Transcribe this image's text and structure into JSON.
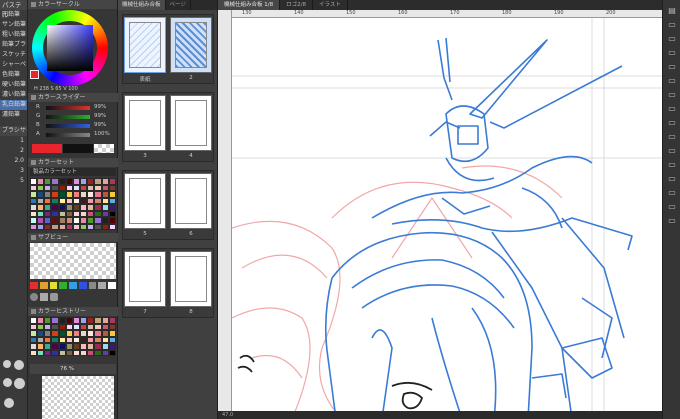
{
  "left_tools": {
    "header": "パステル",
    "items": [
      "円鉛筆",
      "サン鉛筆",
      "粗い鉛筆",
      "鉛筆ブラシ",
      "スケッチ",
      "シャーペン",
      "色鉛筆",
      "硬い鉛筆",
      "濃い鉛筆",
      "乳白鉛筆",
      "濃鉛筆"
    ],
    "selected_index": 9,
    "sub_header": "ブラシサイズ",
    "size_values": [
      "1",
      "2",
      "2.0",
      "3",
      "5"
    ]
  },
  "color_panel": {
    "wheel_title": "カラーサークル",
    "hsv_readout": "H 238 S 65 V 100",
    "slider_title": "カラースライダー",
    "sliders": [
      {
        "label": "R",
        "value": "99%",
        "color": "#e03030"
      },
      {
        "label": "G",
        "value": "99%",
        "color": "#30b030"
      },
      {
        "label": "B",
        "value": "99%",
        "color": "#3060e0"
      },
      {
        "label": "A",
        "value": "100%",
        "color": "#888888"
      }
    ],
    "set_title": "カラーセット",
    "set_name": "製品カラーセット",
    "sub_view_title": "サブビュー",
    "history_title": "カラーヒストリー",
    "layer_opacity": "76 %",
    "main_color": "#e8242c",
    "sub_color": "#111111"
  },
  "page_manager": {
    "tabs": [
      "機械仕組み合板",
      "ページ"
    ],
    "pages": [
      "表紙",
      "2",
      "3",
      "4",
      "5",
      "6",
      "7",
      "8"
    ]
  },
  "canvas": {
    "tabs": [
      "機械仕組み合板 1/8",
      "ロゴ2/8",
      "イラスト"
    ],
    "ruler_labels": [
      "130",
      "140",
      "150",
      "160",
      "170",
      "180",
      "190",
      "200"
    ],
    "zoom": "47.0",
    "sketch_color": "#3b7bd6",
    "underlay_color": "#f2a7a7"
  },
  "right_icons": [
    "layer-icon",
    "folder-icon",
    "folder-icon",
    "folder-icon",
    "folder-icon",
    "folder-icon",
    "folder-icon",
    "folder-icon",
    "folder-icon",
    "folder-icon",
    "folder-icon",
    "folder-icon",
    "folder-icon",
    "folder-icon",
    "folder-icon",
    "folder-icon"
  ]
}
